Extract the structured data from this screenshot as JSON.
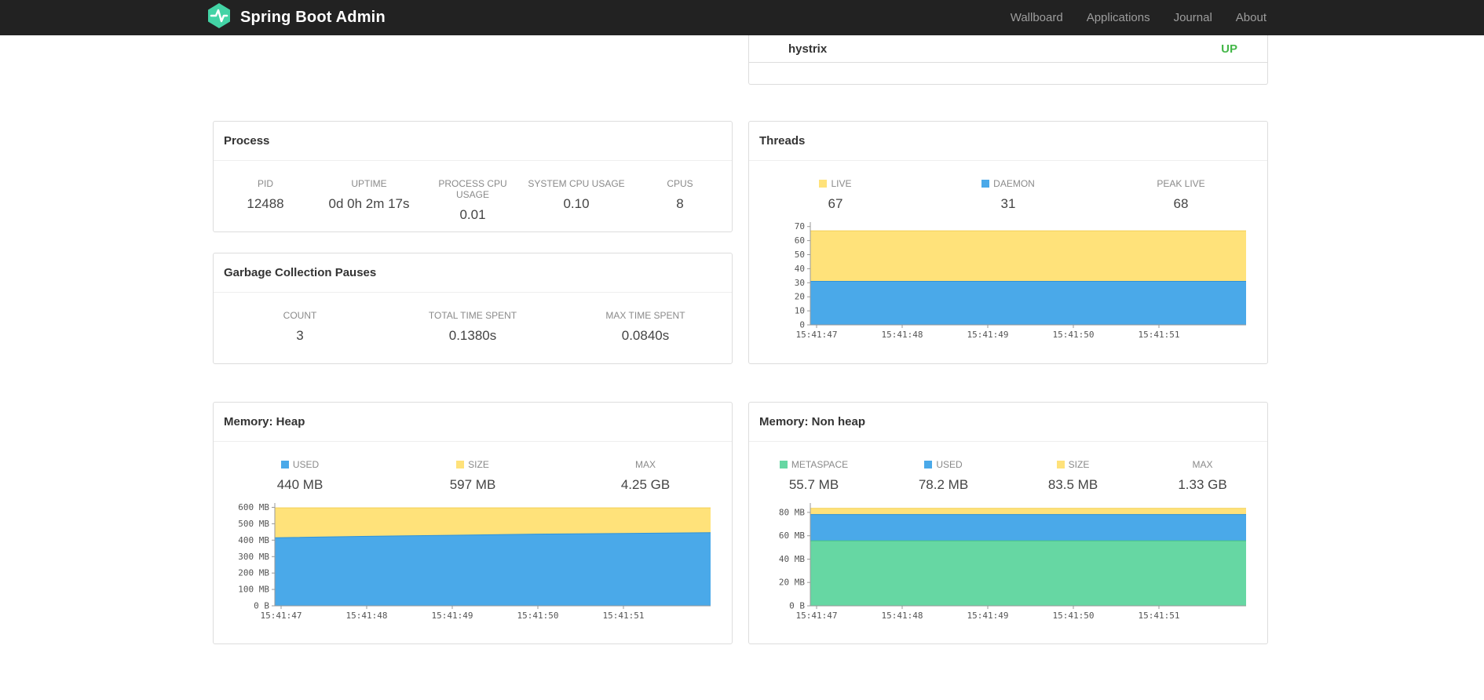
{
  "navbar": {
    "brand": "Spring Boot Admin",
    "items": [
      {
        "label": "Wallboard"
      },
      {
        "label": "Applications"
      },
      {
        "label": "Journal"
      },
      {
        "label": "About"
      }
    ]
  },
  "health": {
    "rows": [
      {
        "name": "hystrix",
        "status": "UP",
        "status_color": "#44b749"
      }
    ]
  },
  "cards": {
    "process": {
      "title": "Process",
      "stats": [
        {
          "label": "PID",
          "value": "12488"
        },
        {
          "label": "UPTIME",
          "value": "0d 0h 2m 17s"
        },
        {
          "label": "PROCESS CPU USAGE",
          "value": "0.01"
        },
        {
          "label": "SYSTEM CPU USAGE",
          "value": "0.10"
        },
        {
          "label": "CPUS",
          "value": "8"
        }
      ]
    },
    "gc": {
      "title": "Garbage Collection Pauses",
      "stats": [
        {
          "label": "COUNT",
          "value": "3"
        },
        {
          "label": "TOTAL TIME SPENT",
          "value": "0.1380s"
        },
        {
          "label": "MAX TIME SPENT",
          "value": "0.0840s"
        }
      ]
    },
    "threads": {
      "title": "Threads",
      "stats": [
        {
          "label": "LIVE",
          "value": "67",
          "color": "#ffe27a"
        },
        {
          "label": "DAEMON",
          "value": "31",
          "color": "#4aa9e9"
        },
        {
          "label": "PEAK LIVE",
          "value": "68"
        }
      ]
    },
    "heap": {
      "title": "Memory: Heap",
      "stats": [
        {
          "label": "USED",
          "value": "440 MB",
          "color": "#4aa9e9"
        },
        {
          "label": "SIZE",
          "value": "597 MB",
          "color": "#ffe27a"
        },
        {
          "label": "MAX",
          "value": "4.25 GB"
        }
      ]
    },
    "nonheap": {
      "title": "Memory: Non heap",
      "stats": [
        {
          "label": "METASPACE",
          "value": "55.7 MB",
          "color": "#66d7a3"
        },
        {
          "label": "USED",
          "value": "78.2 MB",
          "color": "#4aa9e9"
        },
        {
          "label": "SIZE",
          "value": "83.5 MB",
          "color": "#ffe27a"
        },
        {
          "label": "MAX",
          "value": "1.33 GB"
        }
      ]
    }
  },
  "colors": {
    "navbar_bg": "#222222",
    "brand_green": "#43d3a5",
    "status_up": "#44b749",
    "chart_yellow": "#ffe27a",
    "chart_blue": "#4aa9e9",
    "chart_green": "#66d7a3"
  },
  "chart_data": [
    {
      "id": "threads",
      "type": "area",
      "title": "Threads",
      "x_ticks": [
        "15:41:47",
        "15:41:48",
        "15:41:49",
        "15:41:50",
        "15:41:51"
      ],
      "ylim": [
        0,
        71.5
      ],
      "y_ticks": [
        {
          "v": 0,
          "label": "0"
        },
        {
          "v": 10,
          "label": "10"
        },
        {
          "v": 20,
          "label": "20"
        },
        {
          "v": 30,
          "label": "30"
        },
        {
          "v": 40,
          "label": "40"
        },
        {
          "v": 50,
          "label": "50"
        },
        {
          "v": 60,
          "label": "60"
        },
        {
          "v": 70,
          "label": "70"
        }
      ],
      "layers": [
        {
          "name": "live",
          "color": "#ffe27a",
          "stroke": "#f3cf57",
          "values": [
            67,
            67,
            67,
            67,
            67,
            67
          ]
        },
        {
          "name": "daemon",
          "color": "#4aa9e9",
          "stroke": "#2f93d9",
          "values": [
            31,
            31,
            31,
            31,
            31,
            31
          ]
        }
      ]
    },
    {
      "id": "heap",
      "type": "area",
      "title": "Memory: Heap",
      "x_ticks": [
        "15:41:47",
        "15:41:48",
        "15:41:49",
        "15:41:50",
        "15:41:51"
      ],
      "ylim": [
        0,
        612
      ],
      "y_ticks": [
        {
          "v": 0,
          "label": "0 B"
        },
        {
          "v": 100,
          "label": "100 MB"
        },
        {
          "v": 200,
          "label": "200 MB"
        },
        {
          "v": 300,
          "label": "300 MB"
        },
        {
          "v": 400,
          "label": "400 MB"
        },
        {
          "v": 500,
          "label": "500 MB"
        },
        {
          "v": 600,
          "label": "600 MB"
        }
      ],
      "layers": [
        {
          "name": "size",
          "color": "#ffe27a",
          "stroke": "#f3cf57",
          "values": [
            597,
            597,
            597,
            597,
            597,
            597
          ]
        },
        {
          "name": "used",
          "color": "#4aa9e9",
          "stroke": "#2f93d9",
          "values": [
            415,
            423,
            430,
            437,
            441,
            446
          ]
        }
      ]
    },
    {
      "id": "nonheap",
      "type": "area",
      "title": "Memory: Non heap",
      "x_ticks": [
        "15:41:47",
        "15:41:48",
        "15:41:49",
        "15:41:50",
        "15:41:51"
      ],
      "ylim": [
        0,
        86
      ],
      "y_ticks": [
        {
          "v": 0,
          "label": "0 B"
        },
        {
          "v": 20,
          "label": "20 MB"
        },
        {
          "v": 40,
          "label": "40 MB"
        },
        {
          "v": 60,
          "label": "60 MB"
        },
        {
          "v": 80,
          "label": "80 MB"
        }
      ],
      "layers": [
        {
          "name": "size",
          "color": "#ffe27a",
          "stroke": "#f3cf57",
          "values": [
            83.5,
            83.5,
            83.5,
            83.5,
            83.5,
            83.5
          ]
        },
        {
          "name": "used",
          "color": "#4aa9e9",
          "stroke": "#2f93d9",
          "values": [
            78.2,
            78.2,
            78.2,
            78.2,
            78.2,
            78.2
          ]
        },
        {
          "name": "metaspace",
          "color": "#66d7a3",
          "stroke": "#46c287",
          "values": [
            55.7,
            55.7,
            55.7,
            55.7,
            55.7,
            55.7
          ]
        }
      ]
    }
  ]
}
